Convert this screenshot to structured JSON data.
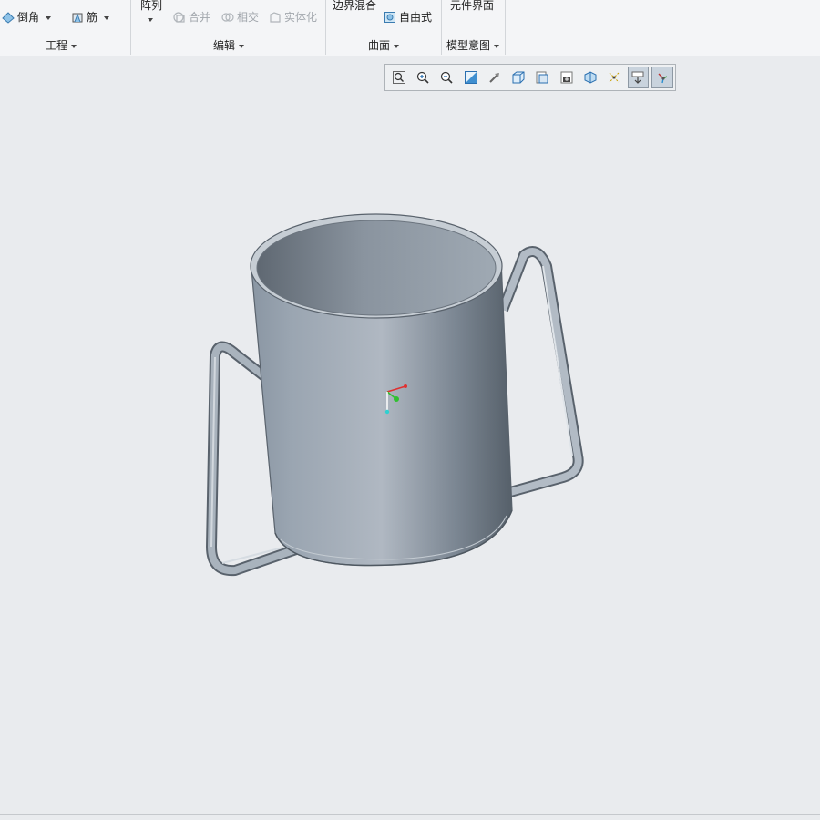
{
  "ribbon": {
    "engineering": {
      "round_label": "倒角",
      "rib_label": "筋",
      "group_label": "工程"
    },
    "edit": {
      "pattern_label": "阵列",
      "merge_label": "合并",
      "intersect_label": "相交",
      "solidify_label": "实体化",
      "group_label": "编辑"
    },
    "surfaces": {
      "boundary_blend_label": "边界混合",
      "freestyle_label": "自由式",
      "group_label": "曲面"
    },
    "model_intent": {
      "component_interface_label": "元件界面",
      "group_label": "模型意图"
    }
  },
  "view_toolbar": {
    "buttons": [
      {
        "icon": "refit-icon"
      },
      {
        "icon": "zoom-in-icon"
      },
      {
        "icon": "zoom-out-icon"
      },
      {
        "icon": "repaint-icon"
      },
      {
        "icon": "perspective-icon"
      },
      {
        "icon": "display-style-icon"
      },
      {
        "icon": "saved-orientations-icon"
      },
      {
        "icon": "view-manager-icon"
      },
      {
        "icon": "section-icon"
      },
      {
        "icon": "datum-display-filters-icon"
      },
      {
        "icon": "annotation-display-icon",
        "active": true
      },
      {
        "icon": "spin-center-icon",
        "active": true
      }
    ]
  },
  "colors": {
    "viewport_bg": "#e9ebee",
    "model_light": "#a3adb8",
    "model_dark": "#5d6670",
    "axis_x": "#e03030",
    "axis_y": "#30c030",
    "axis_z": "#30d0d0"
  }
}
